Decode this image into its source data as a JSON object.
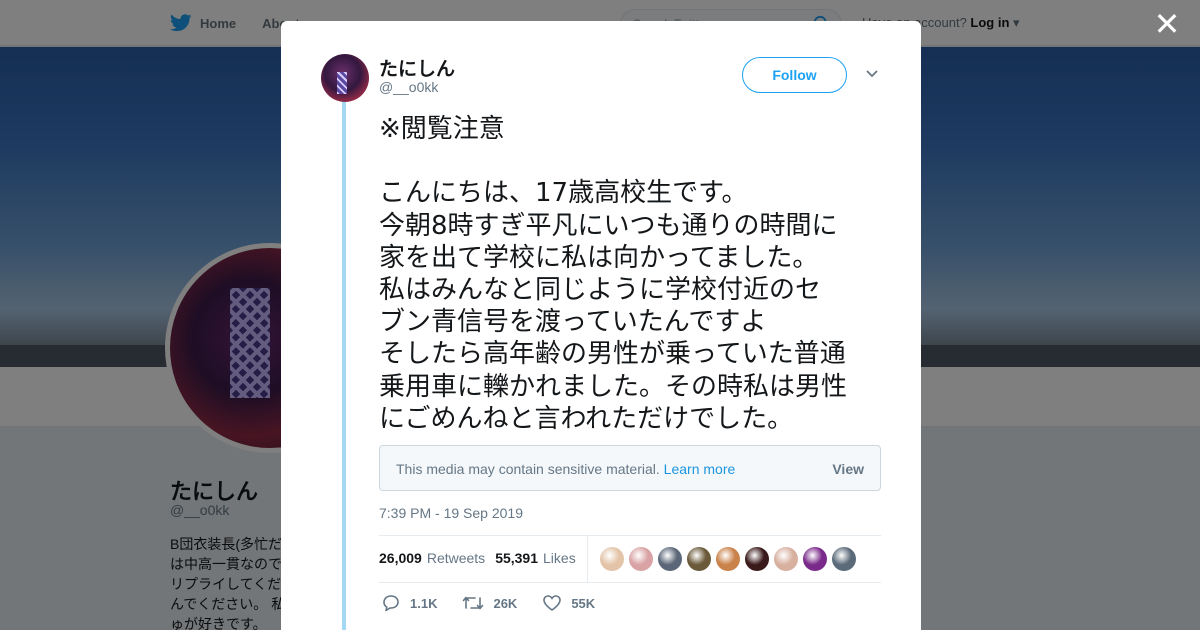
{
  "topbar": {
    "home_label": "Home",
    "about_label": "About",
    "search_placeholder": "Search Twitter",
    "account_prompt": "Have an account?",
    "login_label": "Log in"
  },
  "profile": {
    "name": "たにしん",
    "handle": "@__o0kk",
    "bio": "B団衣装長(多忙だ\nは中高一貫なので\nリプライしてくだ\nんでください。 私\nゅが好きです。"
  },
  "modal": {
    "close_icon": "close-icon",
    "name": "たにしん",
    "handle": "@__o0kk",
    "follow_label": "Follow",
    "text": "※閲覧注意\n\nこんにちは、17歳高校生です。\n今朝8時すぎ平凡にいつも通りの時間に\n家を出て学校に私は向かってました。\n私はみんなと同じように学校付近のセ\nブン青信号を渡っていたんですよ\nそしたら高年齢の男性が乗っていた普通\n乗用車に轢かれました。その時私は男性\nにごめんねと言われただけでした。",
    "sensitive_message": "This media may contain sensitive material.",
    "learn_more_label": "Learn more",
    "view_label": "View",
    "timestamp": "7:39 PM - 19 Sep 2019",
    "retweets_count": "26,009",
    "retweets_label": "Retweets",
    "likes_count": "55,391",
    "likes_label": "Likes",
    "likers": [
      "#e3c4a8",
      "#d9a3a5",
      "#5b6778",
      "#6b5a3a",
      "#c9824a",
      "#3a1a1a",
      "#d8b0a0",
      "#7a2a8a",
      "#5a6a78"
    ],
    "replies_action": "1.1K",
    "retweets_action": "26K",
    "likes_action": "55K"
  },
  "colors": {
    "accent": "#1da1f2",
    "thread_line": "#a5d8f5"
  }
}
